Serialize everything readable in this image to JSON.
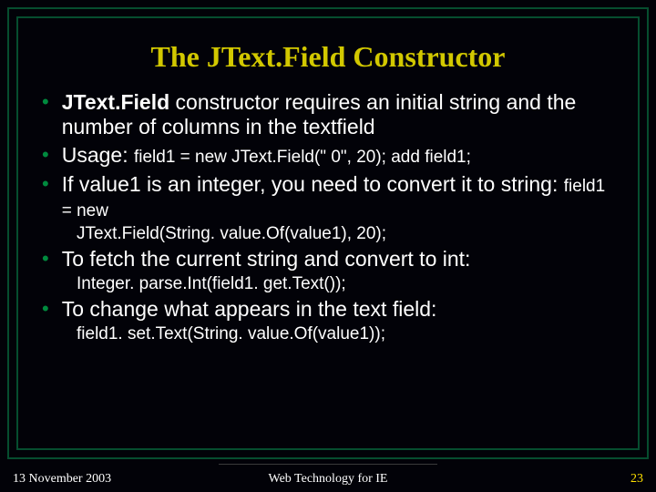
{
  "title": "The JText.Field Constructor",
  "bullets": {
    "b1_bold": "JText.Field",
    "b1_rest": " constructor requires an initial string and the number of columns in the textfield",
    "b2_lead": "Usage: ",
    "b2_code": "field1 = new JText.Field(\" 0\", 20); add field1;",
    "b3_lead": "If value1 is an integer, you need to convert it to string: ",
    "b3_code": "field1 = new",
    "b3_sub": "JText.Field(String. value.Of(value1), 20);",
    "b4": "To fetch the current string and convert to int:",
    "b4_sub": "Integer. parse.Int(field1. get.Text());",
    "b5": "To change what appears in the text field:",
    "b5_sub": "field1. set.Text(String. value.Of(value1));"
  },
  "footer": {
    "date": "13 November 2003",
    "course": "Web Technology for IE",
    "page": "23"
  }
}
